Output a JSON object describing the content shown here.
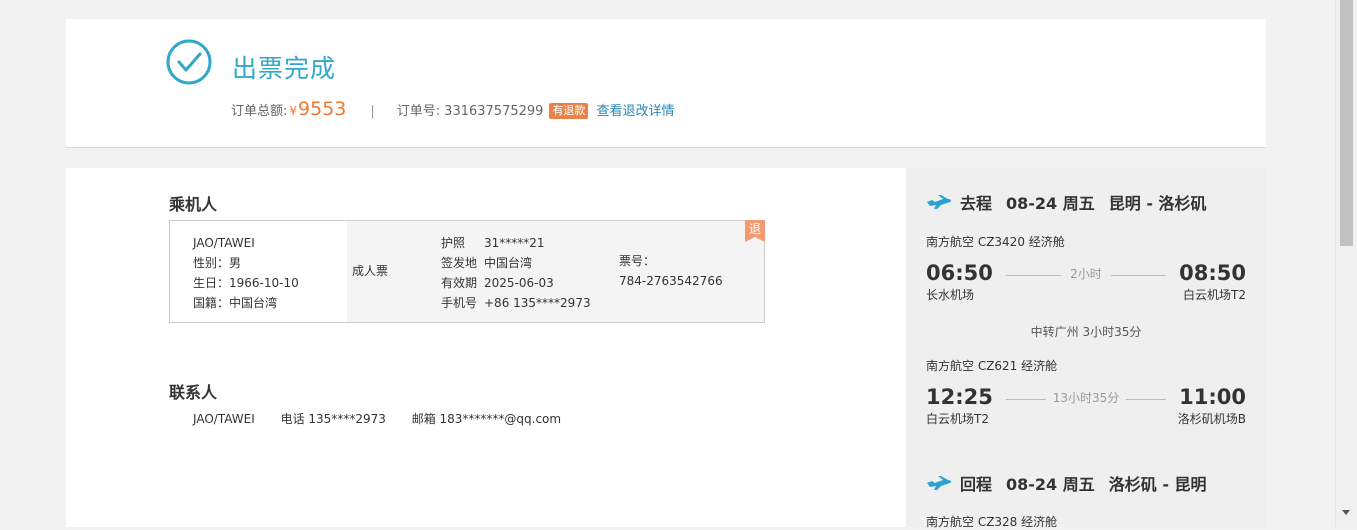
{
  "header": {
    "status_title": "出票完成",
    "total_label": "订单总额:",
    "currency": "¥",
    "total_amount": "9553",
    "separator": "|",
    "order_no_label": "订单号:",
    "order_no": "331637575299",
    "refund_tag": "有退款",
    "refund_detail_link": "查看退改详情",
    "status_color": "#30a8c9",
    "amount_color": "#f07a30"
  },
  "passengers": {
    "title": "乘机人",
    "items": [
      {
        "name": "JAO/TAWEI",
        "gender": "性别：男",
        "birthday": "生日：1966-10-10",
        "nationality": "国籍：中国台湾",
        "ticket_type": "成人票",
        "passport_label": "护照",
        "passport_value": "31*****21",
        "issue_label": "签发地",
        "issue_value": "中国台湾",
        "expiry_label": "有效期",
        "expiry_value": "2025-06-03",
        "phone_label": "手机号",
        "phone_value": "+86 135****2973",
        "ticket_no_label": "票号：",
        "ticket_no": "784-2763542766",
        "refund_badge": "退"
      }
    ]
  },
  "contact": {
    "title": "联系人",
    "name": "JAO/TAWEI",
    "phone": "电话 135****2973",
    "email": "邮箱 183*******@qq.com"
  },
  "flights": {
    "outbound": {
      "direction": "去程",
      "date": "08-24 周五",
      "route": "昆明 - 洛杉矶",
      "segments": [
        {
          "airline": "南方航空 CZ3420 经济舱",
          "dep_time": "06:50",
          "arr_time": "08:50",
          "duration": "2小时",
          "dep_airport": "长水机场",
          "arr_airport": "白云机场T2"
        },
        {
          "airline": "南方航空 CZ621 经济舱",
          "dep_time": "12:25",
          "arr_time": "11:00",
          "duration": "13小时35分",
          "dep_airport": "白云机场T2",
          "arr_airport": "洛杉矶机场B"
        }
      ],
      "transfer": "中转广州 3小时35分"
    },
    "return": {
      "direction": "回程",
      "date": "08-24 周五",
      "route": "洛杉矶 - 昆明",
      "first_airline_cut": "南方航空 CZ328 经济舱"
    }
  }
}
